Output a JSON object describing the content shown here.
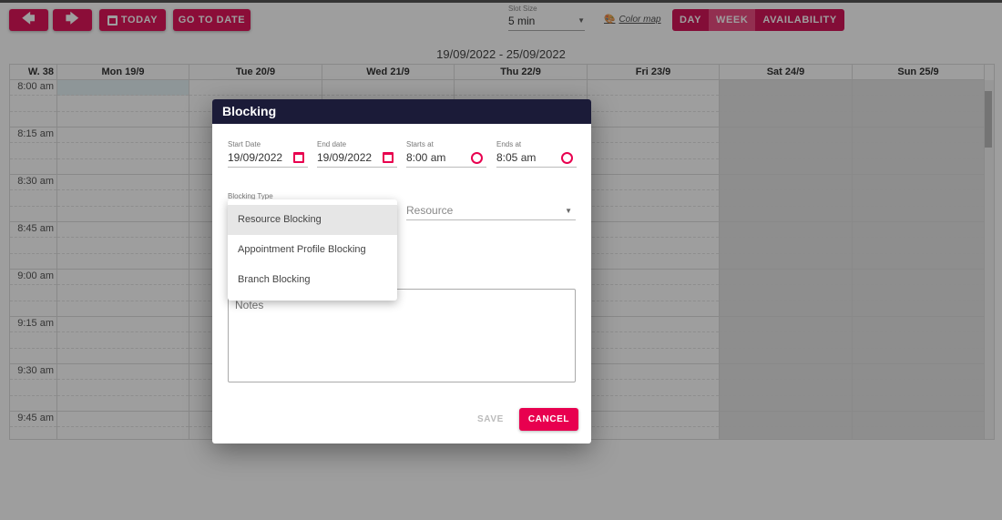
{
  "toolbar": {
    "prev_icon": "arrow-left-icon",
    "next_icon": "arrow-right-icon",
    "today_label": "TODAY",
    "today_icon": "calendar-icon",
    "goto_label": "GO TO DATE",
    "slot_size": {
      "label": "Slot Size",
      "value": "5 min"
    },
    "color_map_label": "Color map",
    "color_map_icon": "palette-icon",
    "views": [
      {
        "label": "DAY",
        "active": false
      },
      {
        "label": "WEEK",
        "active": true
      },
      {
        "label": "AVAILABILITY",
        "active": false
      }
    ],
    "accent": "#e1165b"
  },
  "calendar": {
    "range": "19/09/2022 - 25/09/2022",
    "week_label": "W. 38",
    "days": [
      "Mon 19/9",
      "Tue 20/9",
      "Wed 21/9",
      "Thu 22/9",
      "Fri 23/9",
      "Sat 24/9",
      "Sun 25/9"
    ],
    "times": [
      "8:00 am",
      "8:15 am",
      "8:30 am",
      "8:45 am",
      "9:00 am",
      "9:15 am",
      "9:30 am",
      "9:45 am"
    ]
  },
  "dialog": {
    "title": "Blocking",
    "fields": [
      {
        "label": "Start Date",
        "value": "19/09/2022",
        "icon": "calendar-icon"
      },
      {
        "label": "End date",
        "value": "19/09/2022",
        "icon": "calendar-icon"
      },
      {
        "label": "Starts at",
        "value": "8:00 am",
        "icon": "clock-icon"
      },
      {
        "label": "Ends at",
        "value": "8:05 am",
        "icon": "clock-icon"
      }
    ],
    "blocking_type_label": "Blocking Type",
    "blocking_type_options": [
      "Resource Blocking",
      "Appointment Profile Blocking",
      "Branch Blocking"
    ],
    "highlighted_option": "Resource Blocking",
    "resource_placeholder": "Resource",
    "notes_placeholder": "Notes",
    "save_label": "SAVE",
    "cancel_label": "CANCEL",
    "header_color": "#1b1b38",
    "cancel_color": "#e8004f"
  }
}
